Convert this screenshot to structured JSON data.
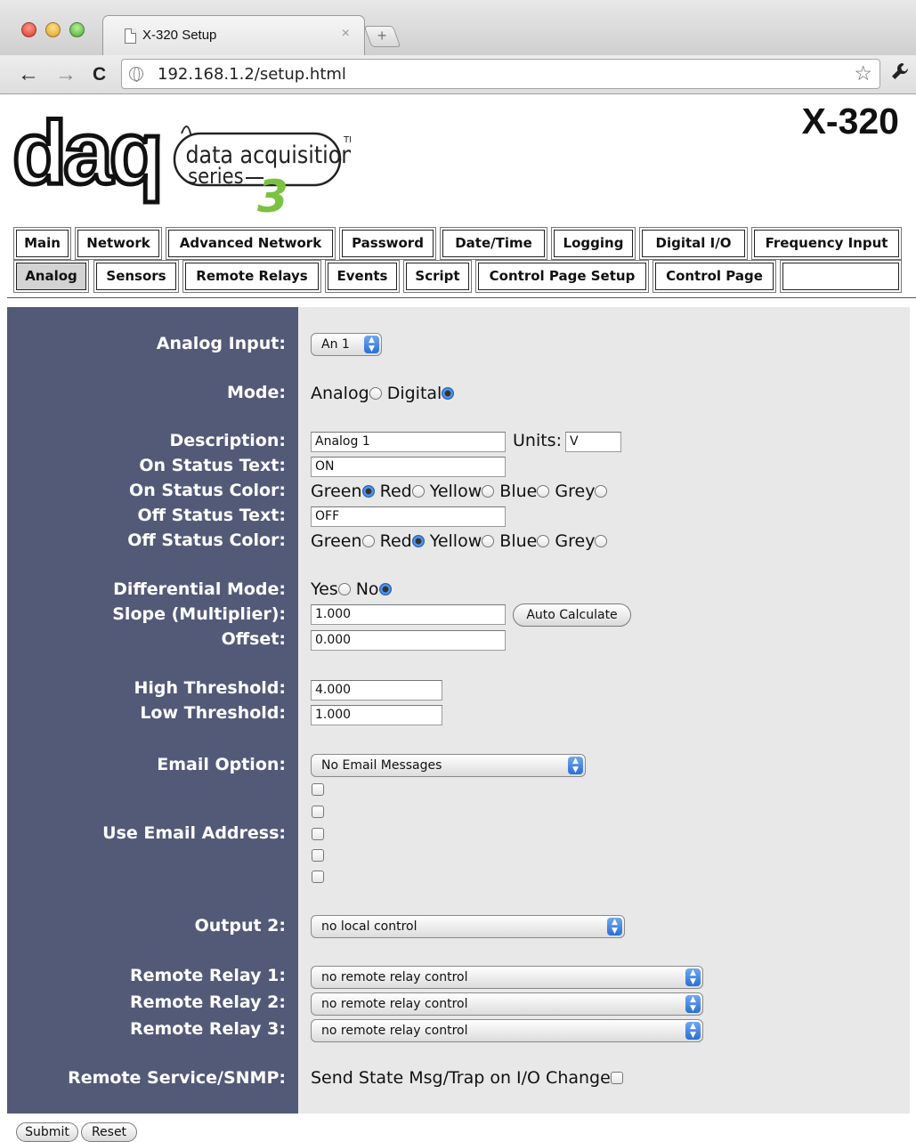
{
  "browser": {
    "tab_title": "X-320 Setup",
    "tab_close": "×",
    "new_tab": "+",
    "url": "192.168.1.2/setup.html",
    "back": "←",
    "forward": "→",
    "reload": "C",
    "star": "☆",
    "wrench": "🔧"
  },
  "header": {
    "logo_main": "daq",
    "logo_tagline1": "data acquisition",
    "logo_tagline2": "series",
    "logo_number": "3",
    "logo_tm": "TM",
    "model": "X-320"
  },
  "nav": {
    "row1": [
      "Main",
      "Network",
      "Advanced Network",
      "Password",
      "Date/Time",
      "Logging",
      "Digital I/O",
      "Frequency Input"
    ],
    "row2": [
      "Analog",
      "Sensors",
      "Remote Relays",
      "Events",
      "Script",
      "Control Page Setup",
      "Control Page",
      ""
    ],
    "active": "Analog"
  },
  "form": {
    "analog_input": {
      "label": "Analog Input:",
      "value": "An 1"
    },
    "mode": {
      "label": "Mode:",
      "options": [
        "Analog",
        "Digital"
      ],
      "selected": "Digital"
    },
    "description": {
      "label": "Description:",
      "value": "Analog 1",
      "units_label": "Units:",
      "units_value": "V"
    },
    "on_status_text": {
      "label": "On Status Text:",
      "value": "ON"
    },
    "on_status_color": {
      "label": "On Status Color:",
      "options": [
        "Green",
        "Red",
        "Yellow",
        "Blue",
        "Grey"
      ],
      "selected": "Green"
    },
    "off_status_text": {
      "label": "Off Status Text:",
      "value": "OFF"
    },
    "off_status_color": {
      "label": "Off Status Color:",
      "options": [
        "Green",
        "Red",
        "Yellow",
        "Blue",
        "Grey"
      ],
      "selected": "Red"
    },
    "differential_mode": {
      "label": "Differential Mode:",
      "options": [
        "Yes",
        "No"
      ],
      "selected": "No"
    },
    "slope": {
      "label": "Slope (Multiplier):",
      "value": "1.000",
      "button": "Auto Calculate"
    },
    "offset": {
      "label": "Offset:",
      "value": "0.000"
    },
    "high_threshold": {
      "label": "High Threshold:",
      "value": "4.000"
    },
    "low_threshold": {
      "label": "Low Threshold:",
      "value": "1.000"
    },
    "email_option": {
      "label": "Email Option:",
      "value": "No Email Messages"
    },
    "use_email_address": {
      "label": "Use Email Address:",
      "count": 5
    },
    "output2": {
      "label": "Output 2:",
      "value": "no local control"
    },
    "remote_relay1": {
      "label": "Remote Relay 1:",
      "value": "no remote relay control"
    },
    "remote_relay2": {
      "label": "Remote Relay 2:",
      "value": "no remote relay control"
    },
    "remote_relay3": {
      "label": "Remote Relay 3:",
      "value": "no remote relay control"
    },
    "snmp": {
      "label": "Remote Service/SNMP:",
      "text": "Send State Msg/Trap on I/O Change"
    }
  },
  "buttons": {
    "submit": "Submit",
    "reset": "Reset"
  },
  "colors": {
    "label_bg": "#535a78",
    "field_bg": "#e8e8e8",
    "logo_green": "#7cc242",
    "active_tab": "#d3d3d3"
  }
}
